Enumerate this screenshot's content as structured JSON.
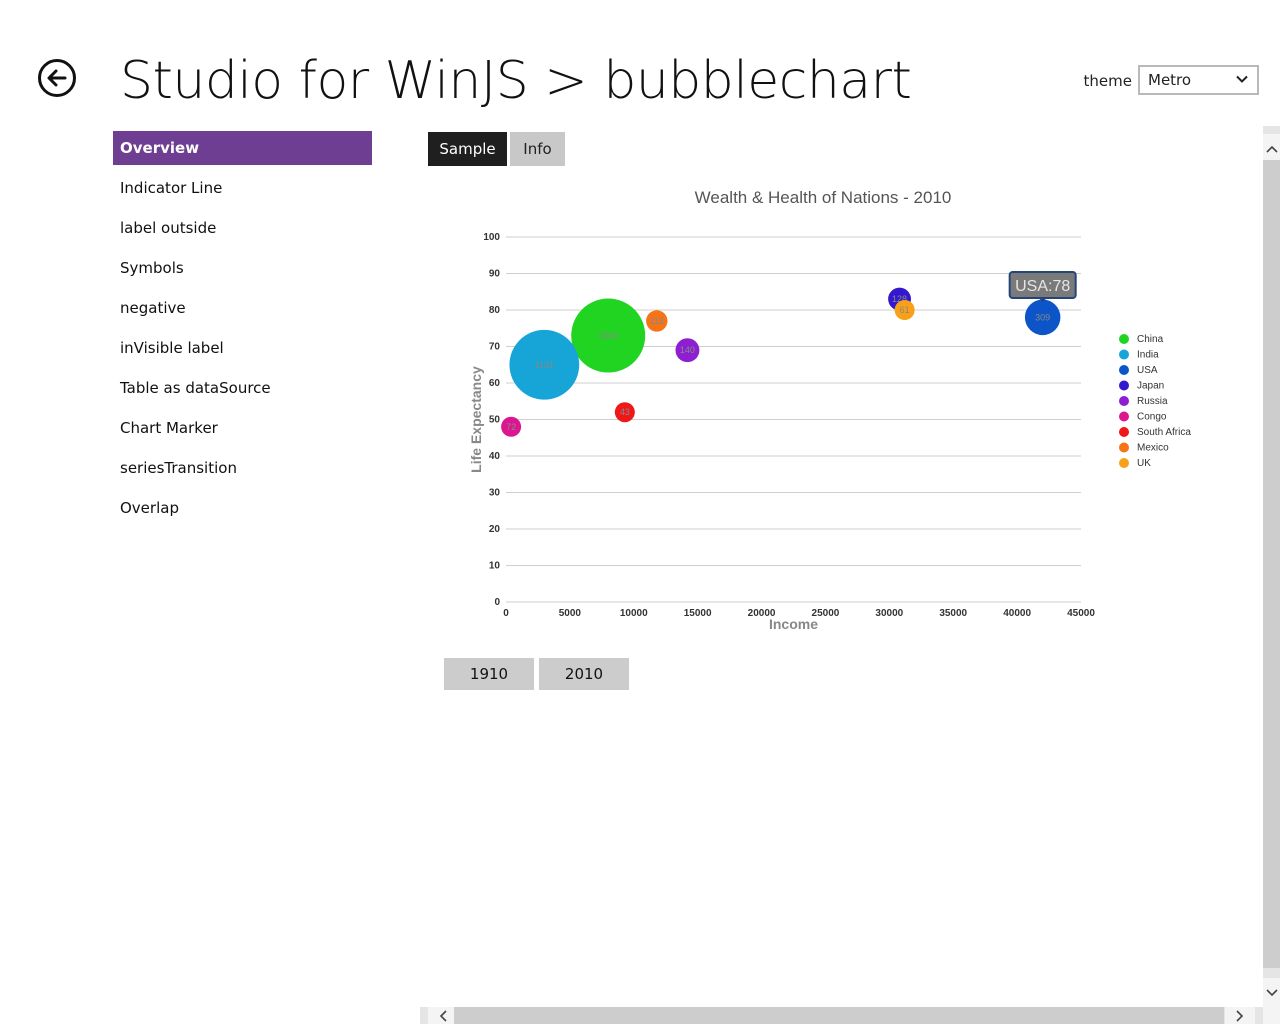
{
  "header": {
    "title": "Studio for WinJS > bubblechart",
    "back_icon": "back-arrow-icon",
    "theme_label": "theme",
    "theme_value": "Metro"
  },
  "sidebar": {
    "items": [
      {
        "label": "Overview",
        "active": true
      },
      {
        "label": "Indicator Line"
      },
      {
        "label": "label outside"
      },
      {
        "label": "Symbols"
      },
      {
        "label": "negative"
      },
      {
        "label": "inVisible label"
      },
      {
        "label": "Table as dataSource"
      },
      {
        "label": "Chart Marker"
      },
      {
        "label": "seriesTransition"
      },
      {
        "label": "Overlap"
      }
    ]
  },
  "tabs": {
    "sample": "Sample",
    "info": "Info"
  },
  "year_buttons": [
    "1910",
    "2010"
  ],
  "tooltip": {
    "text": "USA:78"
  },
  "colors": {
    "accent": "#6e3e92",
    "tab_active": "#1f1f1f",
    "tab_inactive": "#c8c8c8"
  },
  "chart_data": {
    "type": "bubble",
    "title": "Wealth & Health of Nations - 2010",
    "xlabel": "Income",
    "ylabel": "Life Expectancy",
    "xlim": [
      0,
      45000
    ],
    "ylim": [
      0,
      100
    ],
    "xticks": [
      0,
      5000,
      10000,
      15000,
      20000,
      25000,
      30000,
      35000,
      40000,
      45000
    ],
    "yticks": [
      0,
      10,
      20,
      30,
      40,
      50,
      60,
      70,
      80,
      90,
      100
    ],
    "grid": true,
    "legend_position": "right",
    "series": [
      {
        "name": "China",
        "x": 8000,
        "y": 73,
        "size": 1340,
        "label": "1340",
        "color": "#22d422"
      },
      {
        "name": "India",
        "x": 3000,
        "y": 65,
        "size": 1191,
        "label": "1191",
        "color": "#16a5d6"
      },
      {
        "name": "USA",
        "x": 42000,
        "y": 78,
        "size": 309,
        "label": "309",
        "color": "#0b55c9"
      },
      {
        "name": "Japan",
        "x": 30800,
        "y": 83,
        "size": 128,
        "label": "128",
        "color": "#3318d0"
      },
      {
        "name": "Russia",
        "x": 14200,
        "y": 69,
        "size": 140,
        "label": "140",
        "color": "#8e1ed2"
      },
      {
        "name": "Congo",
        "x": 400,
        "y": 48,
        "size": 72,
        "label": "72",
        "color": "#dc168f"
      },
      {
        "name": "South Africa",
        "x": 9300,
        "y": 52,
        "size": 43,
        "label": "43",
        "color": "#ef1818"
      },
      {
        "name": "Mexico",
        "x": 11800,
        "y": 77,
        "size": 112,
        "label": "112",
        "color": "#f67316"
      },
      {
        "name": "UK",
        "x": 31200,
        "y": 80,
        "size": 61,
        "label": "61",
        "color": "#f8a018"
      }
    ]
  }
}
